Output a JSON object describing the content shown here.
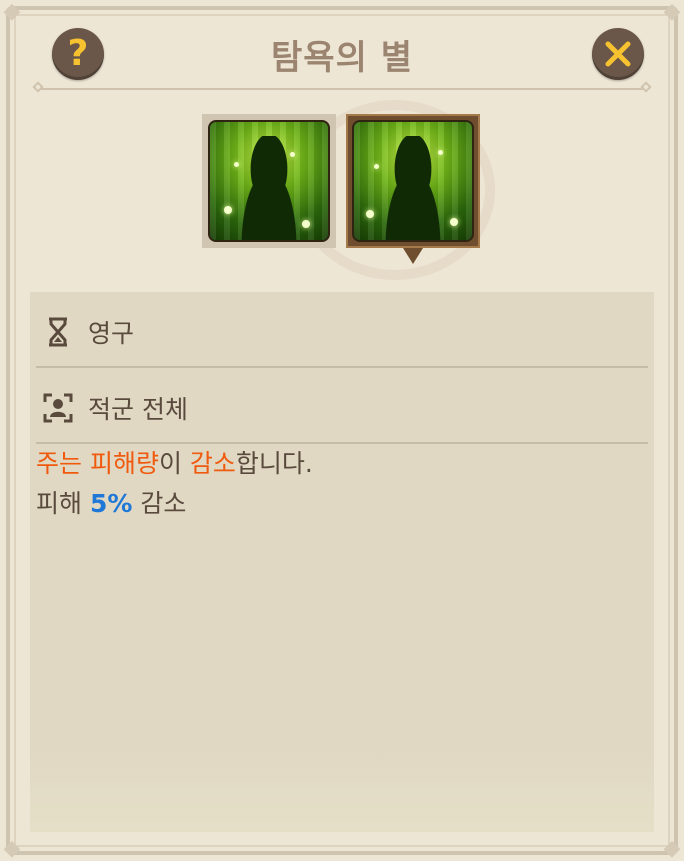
{
  "header": {
    "title": "탐욕의 별",
    "help_icon": "question-icon",
    "close_icon": "close-icon"
  },
  "skills": [
    {
      "icon": "skill-star-of-greed-icon",
      "selected": false
    },
    {
      "icon": "skill-star-of-greed-icon",
      "selected": true
    }
  ],
  "details": {
    "duration": {
      "icon": "hourglass-icon",
      "label": "영구"
    },
    "target": {
      "icon": "target-person-icon",
      "label": "적군 전체"
    }
  },
  "description": {
    "line1": {
      "part1": "주는 피해량",
      "part2": "이 ",
      "part3": "감소",
      "part4": "합니다."
    },
    "line2": {
      "prefix": "피해 ",
      "value": "5%",
      "suffix": " 감소"
    }
  },
  "colors": {
    "accent_orange": "#f05a0e",
    "accent_blue": "#1f78d8",
    "button_bg": "#6b5749",
    "button_glyph": "#f6c230"
  }
}
